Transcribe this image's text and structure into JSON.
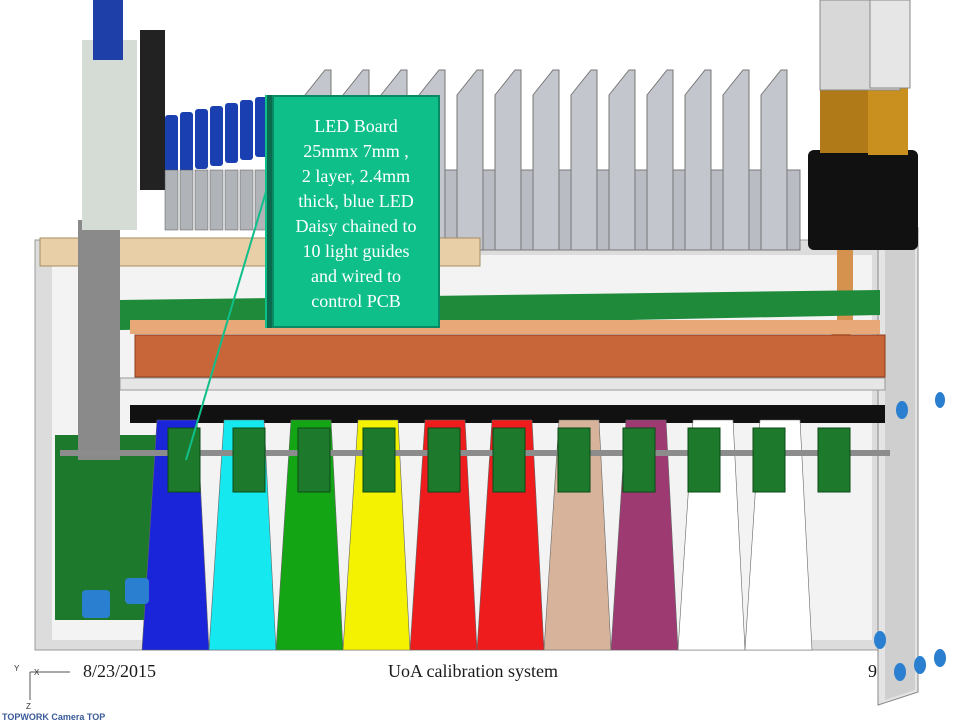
{
  "callout": {
    "lines": [
      "LED Board",
      "25mmx 7mm ,",
      "2 layer, 2.4mm",
      "thick, blue LED",
      "Daisy chained to",
      "10 light guides",
      "and wired to",
      "control PCB"
    ]
  },
  "footer": {
    "date": "8/23/2015",
    "title": "UoA calibration system",
    "page": "9"
  },
  "triad": {
    "y": "Y",
    "x": "X",
    "z": "Z"
  },
  "logo": "TOPWORK Camera TOP",
  "colors": {
    "callout_fill": "#0fbf8a",
    "light_guides": [
      "#1a24d8",
      "#16e8f0",
      "#14a514",
      "#f4f200",
      "#ee1c1c",
      "#ee1c1c",
      "#d6b39a",
      "#9e3a72",
      "#ffffff",
      "#ffffff"
    ],
    "copper_plate": "#c8663a",
    "heatsink": "#c3c6cd"
  }
}
